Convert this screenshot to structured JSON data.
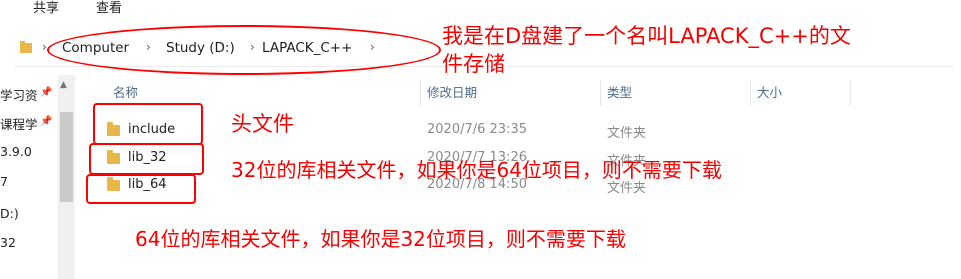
{
  "ribbon": {
    "tabs": [
      "共享",
      "查看"
    ]
  },
  "breadcrumb": {
    "items": [
      "Computer",
      "Study (D:)",
      "LAPACK_C++"
    ]
  },
  "nav": {
    "items": [
      "学习资",
      "课程学",
      "3.9.0",
      "D:)",
      "32",
      "7"
    ]
  },
  "columns": {
    "name": "名称",
    "date": "修改日期",
    "type": "类型",
    "size": "大小"
  },
  "files": [
    {
      "name": "include",
      "date": "2020/7/6 23:35",
      "type": "文件夹"
    },
    {
      "name": "lib_32",
      "date": "2020/7/7 13:26",
      "type": "文件夹"
    },
    {
      "name": "lib_64",
      "date": "2020/7/8 14:50",
      "type": "文件夹"
    }
  ],
  "annotations": {
    "folder_note_line1": "我是在D盘建了一个名叫LAPACK_C++的文",
    "folder_note_line2": "件存储",
    "header_note": "头文件",
    "lib32_note": "32位的库相关文件，如果你是64位项目，则不需要下载",
    "lib64_note": "64位的库相关文件，如果你是32位项目，则不需要下载"
  },
  "colors": {
    "annotation": "#f50000",
    "folder": "#e9b64a",
    "header_text": "#4d6c8a"
  }
}
